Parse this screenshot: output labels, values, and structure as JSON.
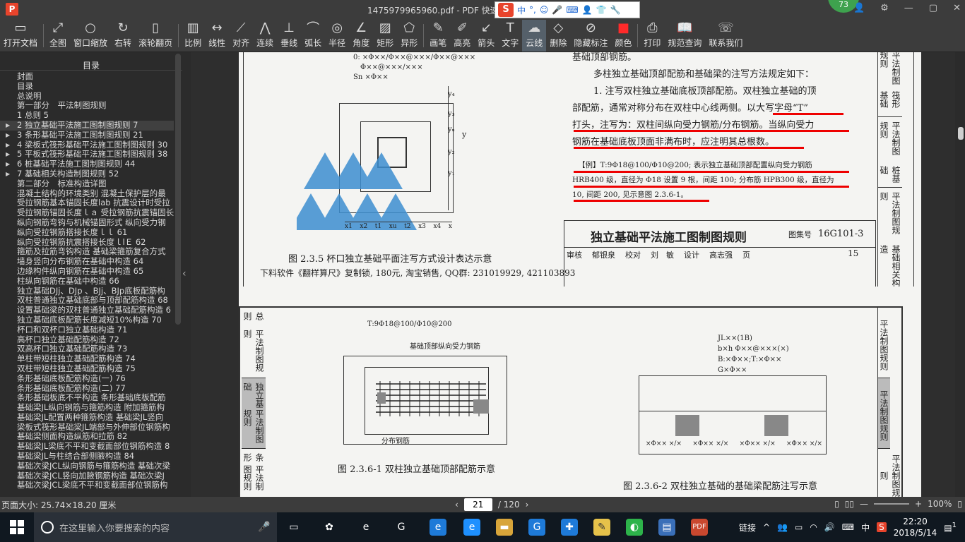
{
  "window": {
    "title": "1475979965960.pdf - PDF 快速看",
    "badge": "73",
    "ime": {
      "lang": "中",
      "punct": "°,"
    }
  },
  "toolbar": [
    {
      "label": "打开文档",
      "icon": "folder-icon",
      "glyph": "▭"
    },
    {
      "label": "全图",
      "icon": "fit-page-icon",
      "glyph": "⤢"
    },
    {
      "label": "窗口缩放",
      "icon": "zoom-icon",
      "glyph": "○"
    },
    {
      "label": "右转",
      "icon": "rotate-right-icon",
      "glyph": "↻"
    },
    {
      "label": "滚轮翻页",
      "icon": "mouse-icon",
      "glyph": "▯"
    },
    {
      "label": "比例",
      "icon": "scale-icon",
      "glyph": "▥"
    },
    {
      "label": "线性",
      "icon": "linear-measure-icon",
      "glyph": "↔"
    },
    {
      "label": "对齐",
      "icon": "aligned-measure-icon",
      "glyph": "⟋"
    },
    {
      "label": "连续",
      "icon": "continuous-measure-icon",
      "glyph": "⋀"
    },
    {
      "label": "垂线",
      "icon": "perpendicular-icon",
      "glyph": "⊥"
    },
    {
      "label": "弧长",
      "icon": "arc-length-icon",
      "glyph": "⌒"
    },
    {
      "label": "半径",
      "icon": "radius-icon",
      "glyph": "◎"
    },
    {
      "label": "角度",
      "icon": "angle-icon",
      "glyph": "∠"
    },
    {
      "label": "矩形",
      "icon": "rectangle-area-icon",
      "glyph": "▨"
    },
    {
      "label": "异形",
      "icon": "polygon-area-icon",
      "glyph": "⬠"
    },
    {
      "label": "画笔",
      "icon": "pen-icon",
      "glyph": "✎"
    },
    {
      "label": "高亮",
      "icon": "highlighter-icon",
      "glyph": "✐"
    },
    {
      "label": "箭头",
      "icon": "arrow-icon",
      "glyph": "↙"
    },
    {
      "label": "文字",
      "icon": "text-icon",
      "glyph": "T"
    },
    {
      "label": "云线",
      "icon": "cloud-line-icon",
      "glyph": "☁"
    },
    {
      "label": "删除",
      "icon": "eraser-icon",
      "glyph": "◇"
    },
    {
      "label": "隐藏标注",
      "icon": "hide-markup-icon",
      "glyph": "⊘"
    },
    {
      "label": "颜色",
      "icon": "color-icon",
      "glyph": "■"
    },
    {
      "label": "打印",
      "icon": "printer-icon",
      "glyph": "⎙"
    },
    {
      "label": "规范查询",
      "icon": "book-search-icon",
      "glyph": "📖"
    },
    {
      "label": "联系我们",
      "icon": "contact-icon",
      "glyph": "☏"
    }
  ],
  "sidebar": {
    "heading": "目录",
    "items": [
      {
        "label": "封面",
        "arrow": false
      },
      {
        "label": "目录",
        "arrow": false
      },
      {
        "label": "总说明",
        "arrow": false
      },
      {
        "label": "第一部分　平法制图规则",
        "arrow": false
      },
      {
        "label": "1 总则 5",
        "arrow": false
      },
      {
        "label": "2 独立基础平法施工图制图规则 7",
        "arrow": true,
        "sel": true
      },
      {
        "label": "3 条形基础平法施工图制图规则 21",
        "arrow": true
      },
      {
        "label": "4 梁板式筏形基础平法施工图制图规则 30",
        "arrow": true
      },
      {
        "label": "5 平板式筏形基础平法施工图制图规则 38",
        "arrow": true
      },
      {
        "label": "6 桩基础平法施工图制图规则 44",
        "arrow": true
      },
      {
        "label": "7 基础相关构造制图规则 52",
        "arrow": true
      },
      {
        "label": "第二部分　标准构造详图",
        "arrow": false
      },
      {
        "label": "混凝土结构的环境类别 混凝土保护层的最",
        "arrow": false
      },
      {
        "label": "受拉钢筋基本锚固长度lab 抗震设计时受拉",
        "arrow": false
      },
      {
        "label": "受拉钢筋锚固长度ｌａ 受拉钢筋抗震锚固长",
        "arrow": false
      },
      {
        "label": "纵向钢筋弯钩与机械锚固形式 纵向受力钢",
        "arrow": false
      },
      {
        "label": "纵向受拉钢筋搭接长度ｌｌ 61",
        "arrow": false
      },
      {
        "label": "纵向受拉钢筋抗震搭接长度ｌlＥ 62",
        "arrow": false
      },
      {
        "label": "箍筋及拉筋弯钩构造 基础梁箍筋复合方式",
        "arrow": false
      },
      {
        "label": "墙身竖向分布钢筋在基础中构造 64",
        "arrow": false
      },
      {
        "label": "边缘构件纵向钢筋在基础中构造 65",
        "arrow": false
      },
      {
        "label": "柱纵向钢筋在基础中构造 66",
        "arrow": false
      },
      {
        "label": "独立基础DJj、DJp 、BJj、BJp底板配筋构",
        "arrow": false
      },
      {
        "label": "双柱普通独立基础底部与顶部配筋构造 68",
        "arrow": false
      },
      {
        "label": "设置基础梁的双柱普通独立基础配筋构造 6",
        "arrow": false
      },
      {
        "label": "独立基础底板配筋长度减短10%构造 70",
        "arrow": false
      },
      {
        "label": "杯口和双杯口独立基础构造 71",
        "arrow": false
      },
      {
        "label": "高杯口独立基础配筋构造 72",
        "arrow": false
      },
      {
        "label": "双高杯口独立基础配筋构造 73",
        "arrow": false
      },
      {
        "label": "单柱带短柱独立基础配筋构造 74",
        "arrow": false
      },
      {
        "label": "双柱带短柱独立基础配筋构造 75",
        "arrow": false
      },
      {
        "label": "条形基础底板配筋构造(一) 76",
        "arrow": false
      },
      {
        "label": "条形基础底板配筋构造(二) 77",
        "arrow": false
      },
      {
        "label": "条形基础板底不平构造 条形基础底板配筋",
        "arrow": false
      },
      {
        "label": "基础梁JL纵向钢筋与箍筋构造 附加箍筋构",
        "arrow": false
      },
      {
        "label": "基础梁JL配置两种箍筋构造 基础梁JL竖向",
        "arrow": false
      },
      {
        "label": "梁板式筏形基础梁JL端部与外伸部位钢筋构",
        "arrow": false
      },
      {
        "label": "基础梁侧面构造纵筋和拉筋 82",
        "arrow": false
      },
      {
        "label": "基础梁JL梁底不平和变截面部位钢筋构造 8",
        "arrow": false
      },
      {
        "label": "基础梁JL与柱结合部侧腋构造 84",
        "arrow": false
      },
      {
        "label": "基础次梁JCL纵向钢筋与箍筋构造 基础次梁",
        "arrow": false
      },
      {
        "label": "基础次梁JCL竖向加腋钢筋构造 基础次梁J",
        "arrow": false
      },
      {
        "label": "基础次梁JCL梁底不平和变截面部位钢筋构",
        "arrow": false
      }
    ]
  },
  "page1": {
    "anno_top1": "0: ×Φ××/Φ××@×××/Φ××@×××",
    "anno_top2": "Φ××@×××/×××",
    "anno_top3": "Sn ×Φ××",
    "dims": [
      "x1",
      "x2",
      "t1",
      "xu",
      "t2",
      "x3",
      "x4",
      "x"
    ],
    "caption1": "图 2.3.5  杯口独立基础平面注写方式设计表达示意",
    "para0": "基础顶部钢筋。",
    "para1": "多柱独立基础顶部配筋和基础梁的注写方法规定如下：",
    "para2a": "1. 注写双柱独立基础底板顶部配筋。双柱独立基础的顶",
    "para2b": "部配筋，通常对称分布在双柱中心线两侧。以大写字母“T”",
    "para2c": "打头，注写为：双柱间纵向受力钢筋/分布钢筋。当纵向受力",
    "para2d": "钢筋在基础底板顶面非满布时，应注明其总根数。",
    "ex1": "【例】T:9Φ18@100/Φ10@200; 表示独立基础顶部配置纵向受力钢筋",
    "ex2": "HRB400 级，直径为 Φ18 设置 9 根，间距 100; 分布筋 HPB300 级，直径为",
    "ex3": "10, 间距 200, 见示意图 2.3.6-1。",
    "title_block": "独立基础平法施工图制图规则",
    "atlas_label": "图集号",
    "atlas_no": "16G101-3",
    "sign_row": [
      "审核",
      "郁银泉",
      "校对",
      "刘　敏",
      "设计",
      "高志强",
      "页"
    ],
    "page_no": "15",
    "footer": "下料软件《翻样算尺》复制锁, 180元, 淘宝销售, QQ群: 231019929, 421103893",
    "side_tabs": [
      "筏形基础",
      "桩基础",
      "基础相关构造"
    ],
    "side_prefix": "平法制图规则"
  },
  "page2": {
    "left_tab1": "总则",
    "left_tab2": "独立基础",
    "left_tab3": "条形",
    "tab_prefix": "平法制图规则",
    "t_label": "T:9Φ18@100/Φ10@200",
    "bar_label": "基础顶部纵向受力钢筋",
    "dist_label": "分布钢筋",
    "caption_a": "图 2.3.6-1  双柱独立基础顶部配筋示意",
    "jl1": "JL××(1B)",
    "jl2": "b×h  Φ××@×××(×)",
    "jl3": "B:×Φ××;T:×Φ××",
    "jl4": "G×Φ××",
    "bottom_marks": [
      "×Φ×× ×/×",
      "×Φ×× ×/×",
      "×Φ×× ×/×",
      "×Φ×× ×/×"
    ],
    "caption_b": "图 2.3.6-2  双柱独立基础的基础梁配筋注写示意",
    "right_tab": "平法制图规则"
  },
  "statusbar": {
    "page_size": "页面大小: 25.74×18.20 厘米",
    "current_page": "21",
    "total_pages": "/ 120",
    "zoom": "100%"
  },
  "taskbar": {
    "search_placeholder": "在这里输入你要搜索的内容",
    "link_label": "链接",
    "ime_lang": "中",
    "time": "22:20",
    "date": "2018/5/14",
    "notify_count": "1"
  }
}
